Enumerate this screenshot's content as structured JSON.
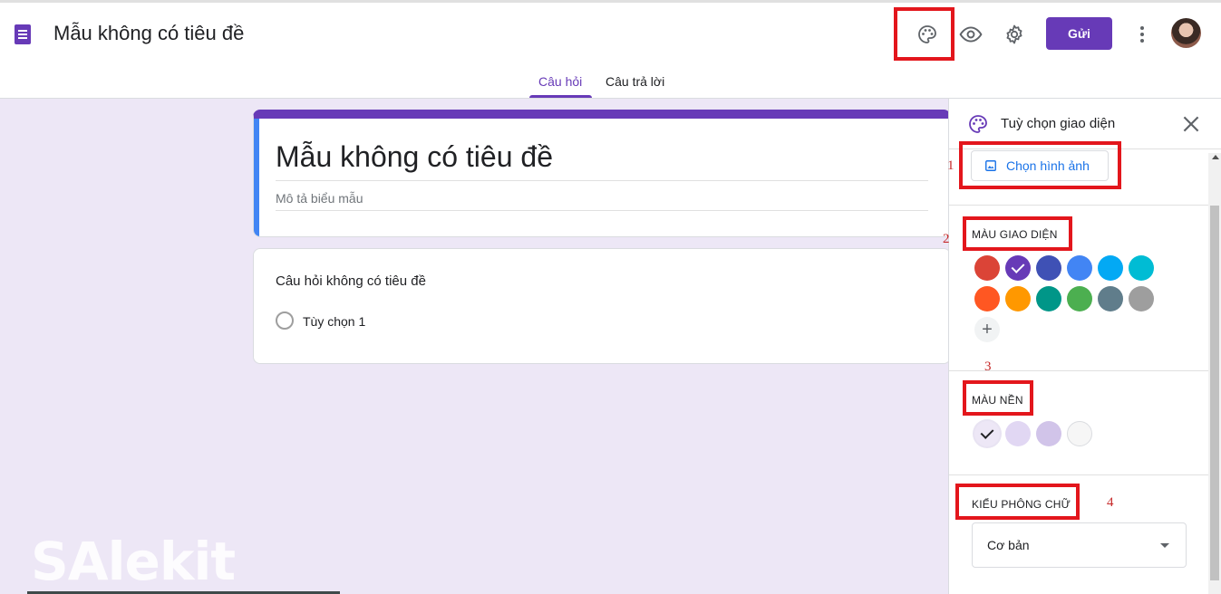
{
  "header": {
    "doc_title": "Mẫu không có tiêu đề",
    "send_label": "Gửi",
    "tabs": [
      {
        "label": "Câu hỏi",
        "active": true
      },
      {
        "label": "Câu trả lời",
        "active": false
      }
    ],
    "icons": [
      "forms-doc-icon",
      "palette-icon",
      "eye-icon",
      "gear-icon",
      "more-vert-icon",
      "avatar"
    ]
  },
  "form": {
    "title": "Mẫu không có tiêu đề",
    "description_placeholder": "Mô tả biểu mẫu",
    "question": {
      "title": "Câu hỏi không có tiêu đề",
      "options": [
        "Tùy chọn 1"
      ]
    }
  },
  "theme_panel": {
    "title": "Tuỳ chọn giao diện",
    "choose_image_label": "Chọn hình ảnh",
    "theme_color_label": "MÀU GIAO DIỆN",
    "background_color_label": "MÀU NỀN",
    "font_style_label": "KIỂU PHÔNG CHỮ",
    "font_style_value": "Cơ bản",
    "theme_colors": [
      "#db4437",
      "#673ab7",
      "#3f51b5",
      "#4285f4",
      "#03a9f4",
      "#00bcd4",
      "#ff5722",
      "#ff9800",
      "#009688",
      "#4caf50",
      "#607d8b",
      "#9e9e9e"
    ],
    "selected_theme_color": "#673ab7",
    "background_colors": [
      "#ede7f6",
      "#e1d7f3",
      "#d1c4e9",
      "#f6f6f6"
    ],
    "selected_background_color": "#ede7f6"
  },
  "annotations": [
    "1",
    "2",
    "3",
    "4"
  ],
  "watermark": "SAlekit",
  "colors": {
    "accent": "#673ab7",
    "annotation_red": "#e3161c"
  }
}
